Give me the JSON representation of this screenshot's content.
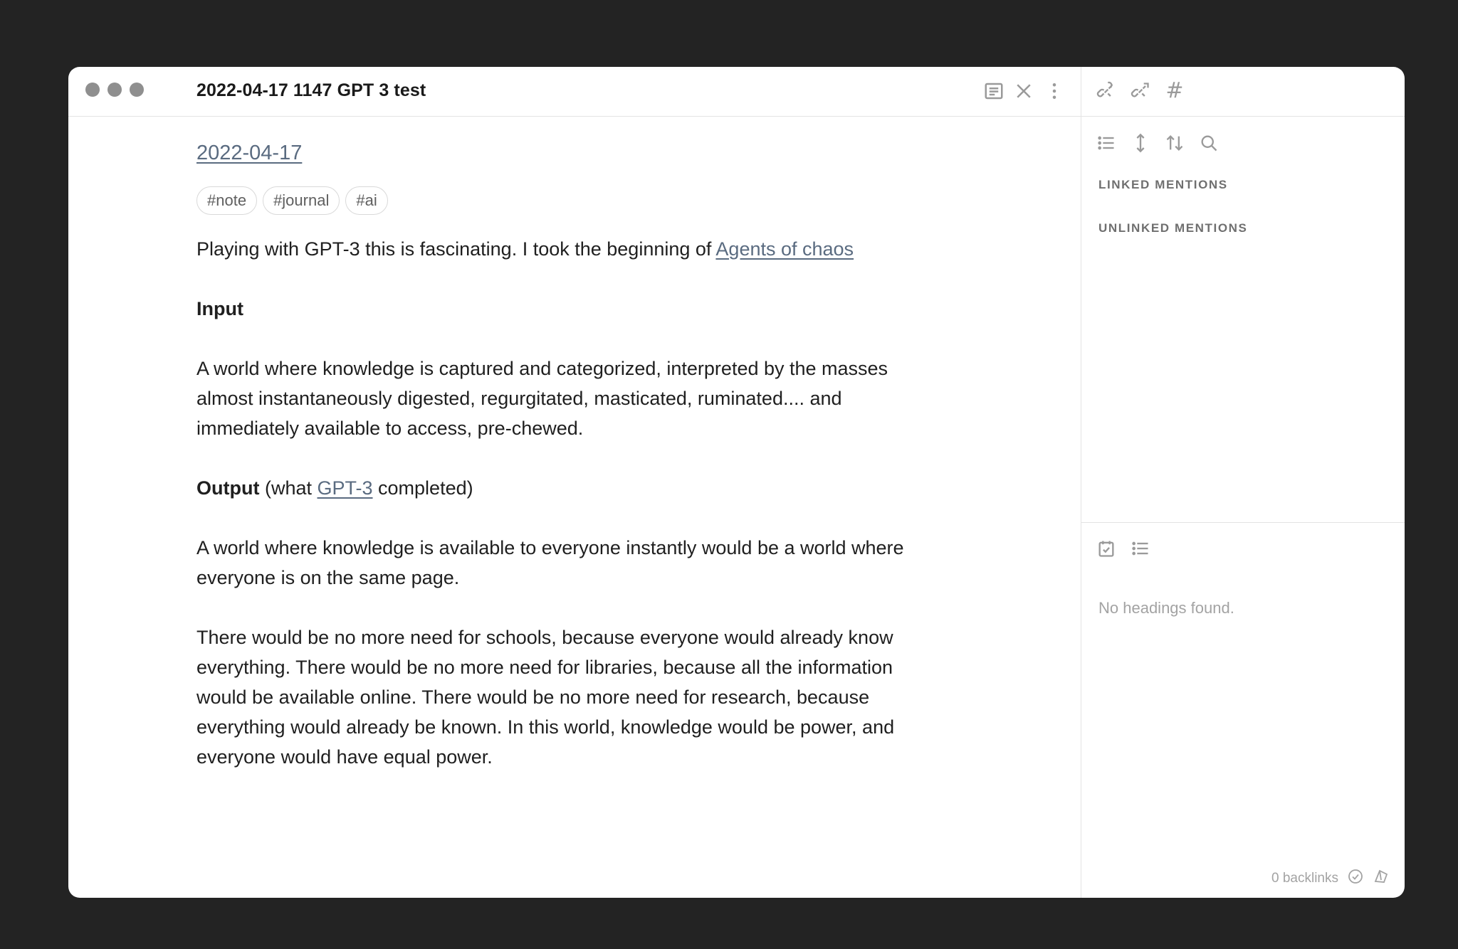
{
  "window": {
    "title": "2022-04-17 1147 GPT 3 test"
  },
  "note": {
    "date_link": "2022-04-17",
    "tags": [
      "#note",
      "#journal",
      "#ai"
    ],
    "intro_text": "Playing with GPT-3 this is fascinating. I took the beginning of ",
    "intro_link": "Agents of chaos",
    "input_heading": "Input",
    "input_text_lines": [
      "A world where knowledge is captured and categorized, interpreted by the masses",
      "almost instantaneously digested, regurgitated, masticated, ruminated.... and",
      "immediately available to access, pre-chewed."
    ],
    "output_heading": "Output",
    "output_paren_start": " (what ",
    "output_link": "GPT-3",
    "output_paren_end": " completed)",
    "answer1_lines": [
      "A world where knowledge is available to everyone instantly would be a world where",
      "everyone is on the same page."
    ],
    "answer2_lines": [
      "There would be no more need for schools, because everyone would already know",
      "everything. There would be no more need for libraries, because all the information",
      "would be available online. There would be no more need for research, because",
      "everything would already be known. In this world, knowledge would be power, and",
      "everyone would have equal power."
    ]
  },
  "sidebar": {
    "linked_mentions": "LINKED MENTIONS",
    "unlinked_mentions": "UNLINKED MENTIONS",
    "no_headings": "No headings found.",
    "backlinks_count": "0 backlinks"
  },
  "icons": {
    "titlebar": [
      "reading-view-icon",
      "close-icon",
      "more-options-icon"
    ],
    "sidebar_tabs": [
      "backlinks-icon",
      "outgoing-links-icon",
      "tags-icon"
    ],
    "sidebar_tools": [
      "list-icon",
      "expand-icon",
      "sort-icon",
      "search-icon"
    ],
    "outline_tabs": [
      "calendar-check-icon",
      "outline-list-icon"
    ],
    "footer": [
      "sync-check-icon",
      "publish-icon"
    ]
  },
  "colors": {
    "link": "#5a6b80",
    "background": "#232323",
    "traffic_light": "#8f8f8f"
  }
}
